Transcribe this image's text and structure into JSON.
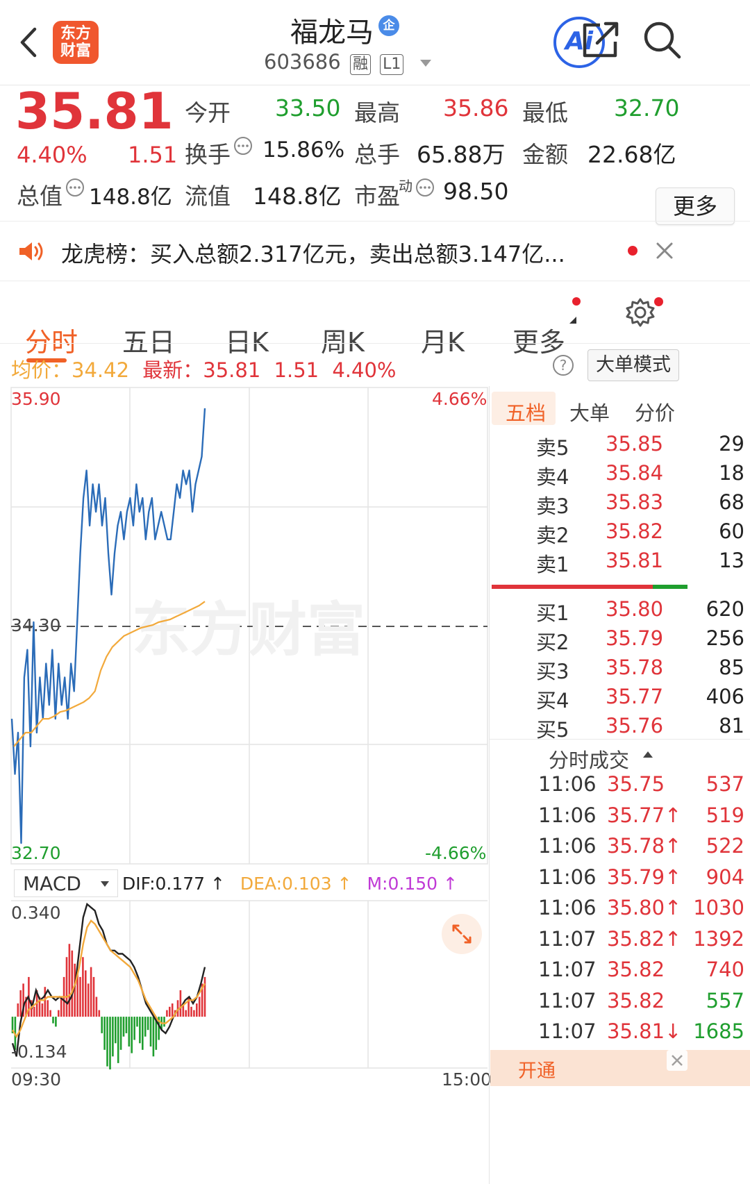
{
  "header": {
    "title": "福龙马",
    "badge": "企",
    "code": "603686",
    "tag1": "融",
    "tag2": "L1",
    "logo_line1": "东方",
    "logo_line2": "财富",
    "ai_label": "Ai"
  },
  "quote": {
    "price": "35.81",
    "change_pct": "4.40%",
    "change": "1.51",
    "rows": [
      [
        {
          "label": "今开",
          "value": "33.50",
          "color": "green"
        },
        {
          "label": "最高",
          "value": "35.86",
          "color": "red"
        },
        {
          "label": "最低",
          "value": "32.70",
          "color": "green"
        }
      ],
      [
        {
          "label": "换手",
          "value": "15.86%",
          "color": "dark"
        },
        {
          "label": "总手",
          "value": "65.88万",
          "color": "dark"
        },
        {
          "label": "金额",
          "value": "22.68亿",
          "color": "dark"
        }
      ]
    ],
    "total_value_label": "总值",
    "total_value": "148.8亿",
    "float_label": "流值",
    "float_value": "148.8亿",
    "pe_label": "市盈",
    "pe_sup": "动",
    "pe_value": "98.50",
    "more_label": "更多"
  },
  "notice": {
    "text": "龙虎榜：买入总额2.317亿元，卖出总额3.147亿..."
  },
  "tabs": [
    "分时",
    "五日",
    "日K",
    "周K",
    "月K",
    "更多"
  ],
  "chart_header": {
    "avg_label": "均价：",
    "avg_value": "34.42",
    "latest_label": "最新：",
    "latest_value": "35.81",
    "latest_change": "1.51",
    "latest_pct": "4.40%",
    "mode_button": "大单模式"
  },
  "chart_data": {
    "type": "line",
    "y_top": "35.90",
    "y_mid": "34.30",
    "y_bottom": "32.70",
    "pct_top": "4.66%",
    "pct_bottom": "-4.66%",
    "ylim": [
      32.7,
      35.9
    ],
    "prev_close": 34.3,
    "watermark": "东方财富",
    "series": [
      {
        "values": [
          33.6,
          33.2,
          33.5,
          32.7,
          33.9,
          34.1,
          33.4,
          34.3,
          33.5,
          33.9,
          33.6,
          34.0,
          33.7,
          34.1,
          33.6,
          34.0,
          33.7,
          33.9,
          33.6,
          34.0,
          33.8,
          34.3,
          34.8,
          35.2,
          35.4,
          35.0,
          35.3,
          35.1,
          35.3,
          35.0,
          35.2,
          34.8,
          34.5,
          34.8,
          35.0,
          35.1,
          34.9,
          35.1,
          35.2,
          35.0,
          35.3,
          35.1,
          35.2,
          34.9,
          35.1,
          35.2,
          34.9,
          35.0,
          35.1,
          35.0,
          34.9,
          34.9,
          35.1,
          35.3,
          35.2,
          35.4,
          35.3,
          35.4,
          35.1,
          35.3,
          35.4,
          35.5,
          35.85
        ],
        "color": "#2b6cb8"
      },
      {
        "values": [
          33.4,
          33.45,
          33.5,
          33.5,
          33.55,
          33.6,
          33.6,
          33.62,
          33.65,
          33.66,
          33.68,
          33.7,
          33.72,
          33.75,
          33.8,
          33.95,
          34.05,
          34.12,
          34.16,
          34.2,
          34.22,
          34.24,
          34.26,
          34.27,
          34.28,
          34.3,
          34.31,
          34.32,
          34.34,
          34.36,
          34.38,
          34.4,
          34.42,
          34.45
        ],
        "color": "#f2a93b"
      }
    ],
    "macd": {
      "label": "MACD",
      "dif_label": "DIF:0.177 ↑",
      "dea_label": "DEA:0.103 ↑",
      "m_label": "M:0.150 ↑",
      "y_top": "0.340",
      "y_bottom": "-0.134",
      "ylim": [
        -0.134,
        0.34
      ],
      "hist": [
        -0.05,
        -0.1,
        0.04,
        0.08,
        0.1,
        0.06,
        0.12,
        0.05,
        0.03,
        0.08,
        0.06,
        0.04,
        0.09,
        0.05,
        0.02,
        -0.02,
        -0.03,
        0.02,
        0.06,
        0.12,
        0.18,
        0.22,
        0.2,
        0.16,
        0.14,
        0.12,
        0.18,
        0.14,
        0.1,
        0.15,
        0.12,
        0.06,
        0.02,
        -0.05,
        -0.1,
        -0.15,
        -0.18,
        -0.12,
        -0.08,
        -0.14,
        -0.1,
        -0.06,
        -0.05,
        -0.09,
        -0.11,
        -0.07,
        -0.03,
        -0.08,
        -0.1,
        -0.06,
        -0.04,
        -0.09,
        -0.12,
        -0.1,
        -0.07,
        -0.04,
        -0.03,
        0.02,
        0.03,
        0.04,
        0.02,
        0.05,
        0.08,
        0.04,
        0.02,
        0.06,
        0.03,
        0.02,
        0.04,
        0.06,
        0.1,
        0.12
      ],
      "dif": [
        -0.08,
        -0.12,
        -0.02,
        0.04,
        0.06,
        0.03,
        0.08,
        0.05,
        0.06,
        0.08,
        0.06,
        0.05,
        0.06,
        0.05,
        0.04,
        0.06,
        0.1,
        0.2,
        0.3,
        0.34,
        0.33,
        0.32,
        0.28,
        0.26,
        0.22,
        0.2,
        0.2,
        0.19,
        0.19,
        0.18,
        0.17,
        0.15,
        0.12,
        0.08,
        0.04,
        0.02,
        0.0,
        -0.02,
        -0.04,
        -0.05,
        -0.03,
        0.0,
        0.02,
        0.03,
        0.05,
        0.06,
        0.04,
        0.06,
        0.1,
        0.15
      ],
      "dea": [
        -0.04,
        -0.06,
        -0.04,
        -0.01,
        0.02,
        0.03,
        0.04,
        0.05,
        0.05,
        0.06,
        0.06,
        0.06,
        0.06,
        0.06,
        0.06,
        0.07,
        0.1,
        0.15,
        0.22,
        0.27,
        0.29,
        0.28,
        0.26,
        0.24,
        0.22,
        0.2,
        0.19,
        0.18,
        0.17,
        0.16,
        0.15,
        0.13,
        0.11,
        0.08,
        0.05,
        0.03,
        0.01,
        -0.01,
        -0.02,
        -0.02,
        -0.01,
        0.0,
        0.02,
        0.03,
        0.04,
        0.05,
        0.05,
        0.06,
        0.08,
        0.1
      ]
    },
    "x_start": "09:30",
    "x_end": "15:00"
  },
  "panel_tabs": [
    "五档",
    "大单",
    "分价"
  ],
  "sell": [
    {
      "label": "卖5",
      "price": "35.85",
      "vol": "29"
    },
    {
      "label": "卖4",
      "price": "35.84",
      "vol": "18"
    },
    {
      "label": "卖3",
      "price": "35.83",
      "vol": "68"
    },
    {
      "label": "卖2",
      "price": "35.82",
      "vol": "60"
    },
    {
      "label": "卖1",
      "price": "35.81",
      "vol": "13"
    }
  ],
  "buy": [
    {
      "label": "买1",
      "price": "35.80",
      "vol": "620"
    },
    {
      "label": "买2",
      "price": "35.79",
      "vol": "256"
    },
    {
      "label": "买3",
      "price": "35.78",
      "vol": "85"
    },
    {
      "label": "买4",
      "price": "35.77",
      "vol": "406"
    },
    {
      "label": "买5",
      "price": "35.76",
      "vol": "81"
    }
  ],
  "ticks_title": "分时成交",
  "ticks": [
    {
      "time": "11:06",
      "price": "35.75",
      "vol": "537",
      "vcolor": "#e0343a"
    },
    {
      "time": "11:06",
      "price": "35.77↑",
      "vol": "519",
      "vcolor": "#e0343a"
    },
    {
      "time": "11:06",
      "price": "35.78↑",
      "vol": "522",
      "vcolor": "#e0343a"
    },
    {
      "time": "11:06",
      "price": "35.79↑",
      "vol": "904",
      "vcolor": "#e0343a"
    },
    {
      "time": "11:06",
      "price": "35.80↑",
      "vol": "1030",
      "vcolor": "#e0343a"
    },
    {
      "time": "11:07",
      "price": "35.82↑",
      "vol": "1392",
      "vcolor": "#e0343a"
    },
    {
      "time": "11:07",
      "price": "35.82",
      "vol": "740",
      "vcolor": "#e0343a"
    },
    {
      "time": "11:07",
      "price": "35.82",
      "vol": "557",
      "vcolor": "#1f9e2e"
    },
    {
      "time": "11:07",
      "price": "35.81↓",
      "vol": "1685",
      "vcolor": "#1f9e2e"
    }
  ],
  "banner_text": "开通"
}
